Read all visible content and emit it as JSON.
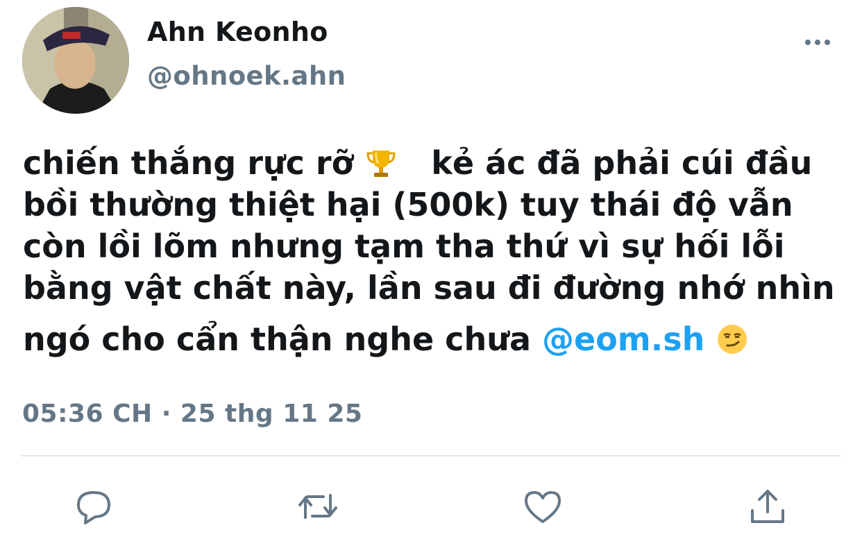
{
  "author": {
    "display_name": "Ahn Keonho",
    "handle": "@ohnoek.ahn"
  },
  "tweet": {
    "lines": [
      "chiến thắng rực rỡ",
      "kẻ ác đã phải cúi đầu",
      "bồi thường thiệt hại (500k) tuy thái độ vẫn",
      "còn lồi lõm nhưng tạm tha thứ vì sự hối lỗi",
      "bằng vật chất này, lần sau đi đường nhớ nhìn",
      "ngó cho cẩn thận nghe chưa"
    ],
    "mention": "@eom.sh",
    "emojis": [
      "trophy-emoji",
      "smirk-emoji"
    ]
  },
  "timestamp": "05:36 CH · 25 thg 11 25",
  "icons": {
    "more": "more-icon",
    "reply": "reply-icon",
    "retweet": "retweet-icon",
    "like": "heart-icon",
    "share": "share-icon"
  },
  "colors": {
    "text": "#14171a",
    "secondary": "#657786",
    "link": "#1da1f2",
    "divider": "#e1e8ed"
  }
}
